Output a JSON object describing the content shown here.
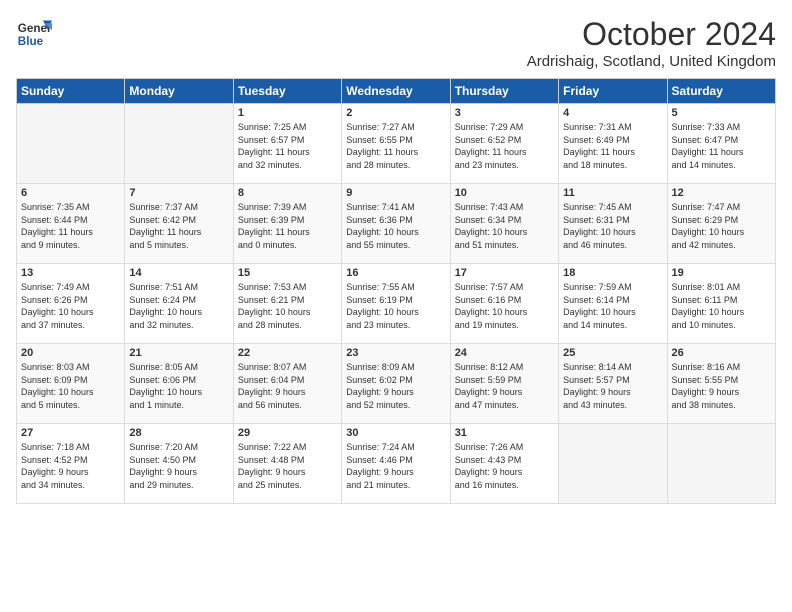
{
  "header": {
    "logo_line1": "General",
    "logo_line2": "Blue",
    "month": "October 2024",
    "location": "Ardrishaig, Scotland, United Kingdom"
  },
  "days_of_week": [
    "Sunday",
    "Monday",
    "Tuesday",
    "Wednesday",
    "Thursday",
    "Friday",
    "Saturday"
  ],
  "weeks": [
    [
      {
        "num": "",
        "info": ""
      },
      {
        "num": "",
        "info": ""
      },
      {
        "num": "1",
        "info": "Sunrise: 7:25 AM\nSunset: 6:57 PM\nDaylight: 11 hours\nand 32 minutes."
      },
      {
        "num": "2",
        "info": "Sunrise: 7:27 AM\nSunset: 6:55 PM\nDaylight: 11 hours\nand 28 minutes."
      },
      {
        "num": "3",
        "info": "Sunrise: 7:29 AM\nSunset: 6:52 PM\nDaylight: 11 hours\nand 23 minutes."
      },
      {
        "num": "4",
        "info": "Sunrise: 7:31 AM\nSunset: 6:49 PM\nDaylight: 11 hours\nand 18 minutes."
      },
      {
        "num": "5",
        "info": "Sunrise: 7:33 AM\nSunset: 6:47 PM\nDaylight: 11 hours\nand 14 minutes."
      }
    ],
    [
      {
        "num": "6",
        "info": "Sunrise: 7:35 AM\nSunset: 6:44 PM\nDaylight: 11 hours\nand 9 minutes."
      },
      {
        "num": "7",
        "info": "Sunrise: 7:37 AM\nSunset: 6:42 PM\nDaylight: 11 hours\nand 5 minutes."
      },
      {
        "num": "8",
        "info": "Sunrise: 7:39 AM\nSunset: 6:39 PM\nDaylight: 11 hours\nand 0 minutes."
      },
      {
        "num": "9",
        "info": "Sunrise: 7:41 AM\nSunset: 6:36 PM\nDaylight: 10 hours\nand 55 minutes."
      },
      {
        "num": "10",
        "info": "Sunrise: 7:43 AM\nSunset: 6:34 PM\nDaylight: 10 hours\nand 51 minutes."
      },
      {
        "num": "11",
        "info": "Sunrise: 7:45 AM\nSunset: 6:31 PM\nDaylight: 10 hours\nand 46 minutes."
      },
      {
        "num": "12",
        "info": "Sunrise: 7:47 AM\nSunset: 6:29 PM\nDaylight: 10 hours\nand 42 minutes."
      }
    ],
    [
      {
        "num": "13",
        "info": "Sunrise: 7:49 AM\nSunset: 6:26 PM\nDaylight: 10 hours\nand 37 minutes."
      },
      {
        "num": "14",
        "info": "Sunrise: 7:51 AM\nSunset: 6:24 PM\nDaylight: 10 hours\nand 32 minutes."
      },
      {
        "num": "15",
        "info": "Sunrise: 7:53 AM\nSunset: 6:21 PM\nDaylight: 10 hours\nand 28 minutes."
      },
      {
        "num": "16",
        "info": "Sunrise: 7:55 AM\nSunset: 6:19 PM\nDaylight: 10 hours\nand 23 minutes."
      },
      {
        "num": "17",
        "info": "Sunrise: 7:57 AM\nSunset: 6:16 PM\nDaylight: 10 hours\nand 19 minutes."
      },
      {
        "num": "18",
        "info": "Sunrise: 7:59 AM\nSunset: 6:14 PM\nDaylight: 10 hours\nand 14 minutes."
      },
      {
        "num": "19",
        "info": "Sunrise: 8:01 AM\nSunset: 6:11 PM\nDaylight: 10 hours\nand 10 minutes."
      }
    ],
    [
      {
        "num": "20",
        "info": "Sunrise: 8:03 AM\nSunset: 6:09 PM\nDaylight: 10 hours\nand 5 minutes."
      },
      {
        "num": "21",
        "info": "Sunrise: 8:05 AM\nSunset: 6:06 PM\nDaylight: 10 hours\nand 1 minute."
      },
      {
        "num": "22",
        "info": "Sunrise: 8:07 AM\nSunset: 6:04 PM\nDaylight: 9 hours\nand 56 minutes."
      },
      {
        "num": "23",
        "info": "Sunrise: 8:09 AM\nSunset: 6:02 PM\nDaylight: 9 hours\nand 52 minutes."
      },
      {
        "num": "24",
        "info": "Sunrise: 8:12 AM\nSunset: 5:59 PM\nDaylight: 9 hours\nand 47 minutes."
      },
      {
        "num": "25",
        "info": "Sunrise: 8:14 AM\nSunset: 5:57 PM\nDaylight: 9 hours\nand 43 minutes."
      },
      {
        "num": "26",
        "info": "Sunrise: 8:16 AM\nSunset: 5:55 PM\nDaylight: 9 hours\nand 38 minutes."
      }
    ],
    [
      {
        "num": "27",
        "info": "Sunrise: 7:18 AM\nSunset: 4:52 PM\nDaylight: 9 hours\nand 34 minutes."
      },
      {
        "num": "28",
        "info": "Sunrise: 7:20 AM\nSunset: 4:50 PM\nDaylight: 9 hours\nand 29 minutes."
      },
      {
        "num": "29",
        "info": "Sunrise: 7:22 AM\nSunset: 4:48 PM\nDaylight: 9 hours\nand 25 minutes."
      },
      {
        "num": "30",
        "info": "Sunrise: 7:24 AM\nSunset: 4:46 PM\nDaylight: 9 hours\nand 21 minutes."
      },
      {
        "num": "31",
        "info": "Sunrise: 7:26 AM\nSunset: 4:43 PM\nDaylight: 9 hours\nand 16 minutes."
      },
      {
        "num": "",
        "info": ""
      },
      {
        "num": "",
        "info": ""
      }
    ]
  ]
}
